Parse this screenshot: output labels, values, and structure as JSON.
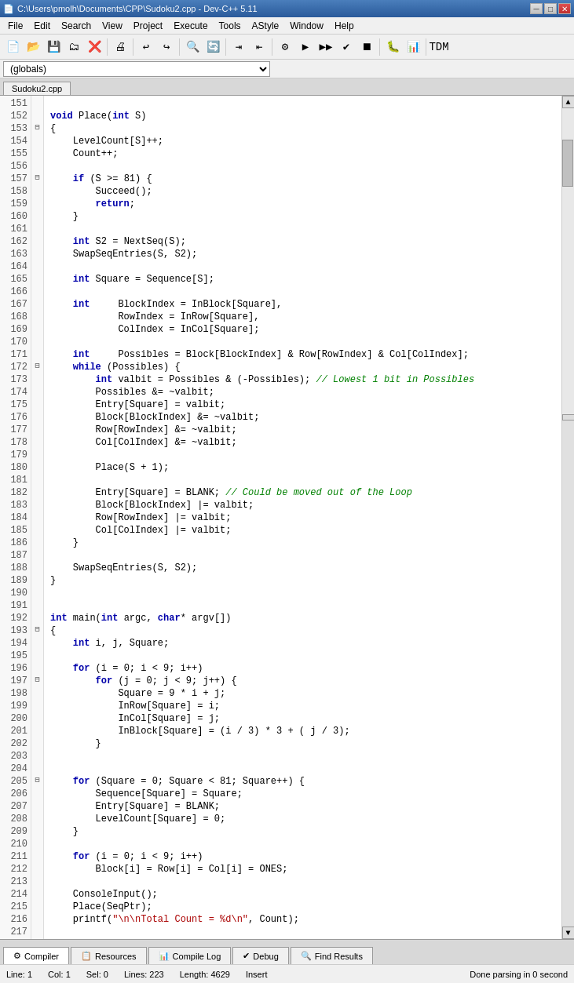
{
  "window": {
    "title": "C:\\Users\\pmolh\\Documents\\CPP\\Sudoku2.cpp - Dev-C++ 5.11",
    "min_btn": "─",
    "max_btn": "□",
    "close_btn": "✕"
  },
  "menu": {
    "items": [
      "File",
      "Edit",
      "Search",
      "View",
      "Project",
      "Execute",
      "Tools",
      "AStyle",
      "Window",
      "Help"
    ]
  },
  "dropdown": {
    "value": "(globals)"
  },
  "tabs": {
    "active": "Sudoku2.cpp"
  },
  "status": {
    "line": "Line:  1",
    "col": "Col:  1",
    "sel": "Sel:  0",
    "lines": "Lines:  223",
    "length": "Length:  4629",
    "mode": "Insert",
    "message": "Done parsing in 0 second"
  },
  "bottom_tabs": [
    "Compiler",
    "Resources",
    "Compile Log",
    "Debug",
    "Find Results"
  ]
}
